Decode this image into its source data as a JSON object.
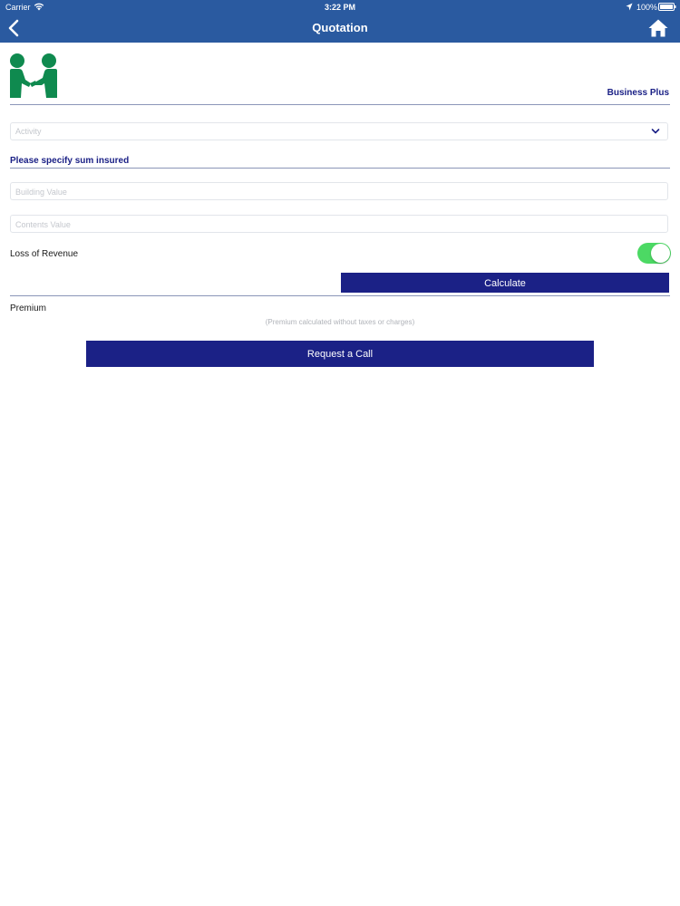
{
  "status_bar": {
    "carrier": "Carrier",
    "wifi_icon": "wifi-icon",
    "time": "3:22 PM",
    "location_icon": "location-arrow-icon",
    "battery": "100%",
    "battery_icon": "battery-icon"
  },
  "nav": {
    "title": "Quotation",
    "back_icon": "chevron-left-icon",
    "home_icon": "home-icon"
  },
  "header": {
    "logo_icon": "handshake-people-icon",
    "product_name": "Business Plus"
  },
  "form": {
    "activity": {
      "placeholder": "Activity",
      "icon": "chevron-down-icon"
    },
    "sum_insured_heading": "Please specify sum insured",
    "building_value": {
      "placeholder": "Building Value",
      "value": ""
    },
    "contents_value": {
      "placeholder": "Contents Value",
      "value": ""
    },
    "loss_of_revenue": {
      "label": "Loss of Revenue",
      "enabled": true
    },
    "calculate_label": "Calculate"
  },
  "result": {
    "premium_label": "Premium",
    "premium_note": "(Premium calculated without taxes or charges)",
    "request_call_label": "Request a Call"
  },
  "colors": {
    "nav_bar": "#2a5aa0",
    "brand_navy": "#1b2186",
    "logo_green": "#0f8a4f",
    "toggle_on": "#4cd964",
    "divider": "#8b96b8"
  }
}
